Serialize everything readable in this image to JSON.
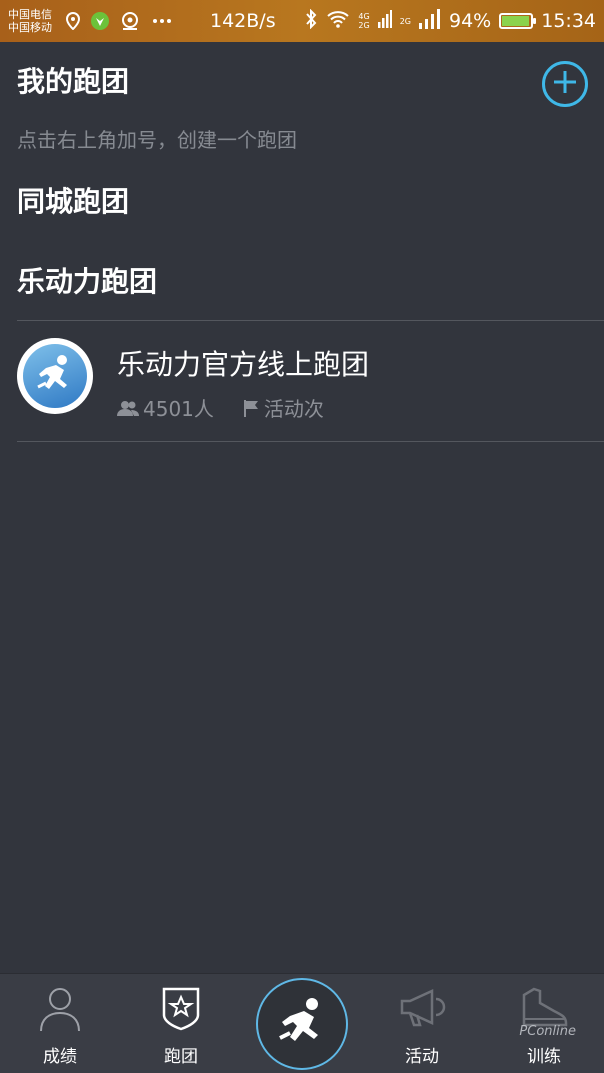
{
  "statusbar": {
    "carrier1": "中国电信",
    "carrier2": "中国移动",
    "net_speed": "142B/s",
    "sig_tag_top": "4G",
    "sig_tag_bottom": "2G",
    "sig_tag_2g": "2G",
    "battery": "94%",
    "time": "15:34",
    "battery_level": 0.94,
    "battery_color": "#8bd34d"
  },
  "page": {
    "title": "我的跑团",
    "hint": "点击右上角加号，创建一个跑团",
    "section_city": "同城跑团",
    "section_brand": "乐动力跑团",
    "accent_color": "#3fb8e8"
  },
  "clubs": [
    {
      "name": "乐动力官方线上跑团",
      "members": "4501人",
      "activities": "活动次"
    }
  ],
  "nav": {
    "items": [
      {
        "label": "成绩",
        "icon": "person-icon"
      },
      {
        "label": "跑团",
        "icon": "badge-star-icon"
      },
      {
        "label": "",
        "icon": "runner-icon"
      },
      {
        "label": "活动",
        "icon": "megaphone-icon"
      },
      {
        "label": "训练",
        "icon": "shoe-icon"
      }
    ]
  },
  "watermark": "PConline"
}
